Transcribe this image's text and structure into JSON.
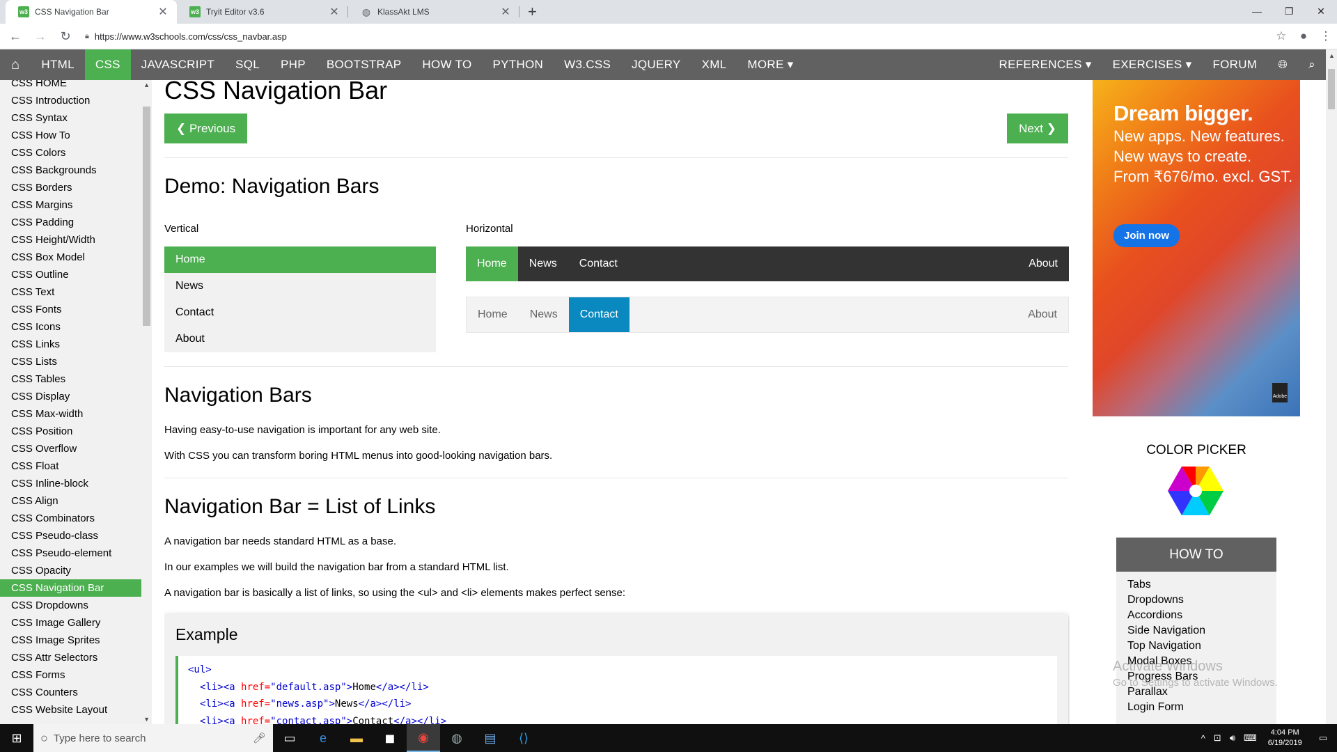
{
  "browser": {
    "tabs": [
      {
        "title": "CSS Navigation Bar",
        "active": true,
        "favicon": "w3schools-icon"
      },
      {
        "title": "Tryit Editor v3.6",
        "active": false,
        "favicon": "w3schools-icon"
      },
      {
        "title": "KlassAkt LMS",
        "active": false,
        "favicon": "globe-icon"
      }
    ],
    "url": "https://www.w3schools.com/css/css_navbar.asp"
  },
  "topnav": {
    "items": [
      "HTML",
      "CSS",
      "JAVASCRIPT",
      "SQL",
      "PHP",
      "BOOTSTRAP",
      "HOW TO",
      "PYTHON",
      "W3.CSS",
      "JQUERY",
      "XML",
      "MORE ▾"
    ],
    "active": "CSS",
    "right_items": [
      "REFERENCES ▾",
      "EXERCISES ▾",
      "FORUM"
    ]
  },
  "sidebar": {
    "links": [
      "CSS HOME",
      "CSS Introduction",
      "CSS Syntax",
      "CSS How To",
      "CSS Colors",
      "CSS Backgrounds",
      "CSS Borders",
      "CSS Margins",
      "CSS Padding",
      "CSS Height/Width",
      "CSS Box Model",
      "CSS Outline",
      "CSS Text",
      "CSS Fonts",
      "CSS Icons",
      "CSS Links",
      "CSS Lists",
      "CSS Tables",
      "CSS Display",
      "CSS Max-width",
      "CSS Position",
      "CSS Overflow",
      "CSS Float",
      "CSS Inline-block",
      "CSS Align",
      "CSS Combinators",
      "CSS Pseudo-class",
      "CSS Pseudo-element",
      "CSS Opacity",
      "CSS Navigation Bar",
      "CSS Dropdowns",
      "CSS Image Gallery",
      "CSS Image Sprites",
      "CSS Attr Selectors",
      "CSS Forms",
      "CSS Counters",
      "CSS Website Layout"
    ],
    "active": "CSS Navigation Bar"
  },
  "main": {
    "title": "CSS Navigation Bar",
    "prev_label": "❮ Previous",
    "next_label": "Next ❯",
    "demo_heading": "Demo: Navigation Bars",
    "vertical_label": "Vertical",
    "horizontal_label": "Horizontal",
    "vertical_items": [
      "Home",
      "News",
      "Contact",
      "About"
    ],
    "horizontal1": {
      "left": [
        "Home",
        "News",
        "Contact"
      ],
      "right": "About",
      "active": "Home"
    },
    "horizontal2": {
      "left": [
        "Home",
        "News",
        "Contact"
      ],
      "right": "About",
      "active": "Contact"
    },
    "navbars_heading": "Navigation Bars",
    "navbars_p1": "Having easy-to-use navigation is important for any web site.",
    "navbars_p2": "With CSS you can transform boring HTML menus into good-looking navigation bars.",
    "list_heading": "Navigation Bar = List of Links",
    "list_p1": "A navigation bar needs standard HTML as a base.",
    "list_p2": "In our examples we will build the navigation bar from a standard HTML list.",
    "list_p3": "A navigation bar is basically a list of links, so using the <ul> and <li> elements makes perfect sense:",
    "example_title": "Example",
    "code": {
      "l1": "<ul>",
      "l2": [
        {
          "c": "t",
          "s": "<li><a "
        },
        {
          "c": "a",
          "s": "href="
        },
        {
          "c": "v",
          "s": "\"default.asp\""
        },
        {
          "c": "t",
          "s": ">"
        },
        {
          "c": "tx",
          "s": "Home"
        },
        {
          "c": "t",
          "s": "</a></li>"
        }
      ],
      "l3": [
        {
          "c": "t",
          "s": "<li><a "
        },
        {
          "c": "a",
          "s": "href="
        },
        {
          "c": "v",
          "s": "\"news.asp\""
        },
        {
          "c": "t",
          "s": ">"
        },
        {
          "c": "tx",
          "s": "News"
        },
        {
          "c": "t",
          "s": "</a></li>"
        }
      ],
      "l4": [
        {
          "c": "t",
          "s": "<li><a "
        },
        {
          "c": "a",
          "s": "href="
        },
        {
          "c": "v",
          "s": "\"contact.asp\""
        },
        {
          "c": "t",
          "s": ">"
        },
        {
          "c": "tx",
          "s": "Contact"
        },
        {
          "c": "t",
          "s": "</a></li>"
        }
      ]
    }
  },
  "ad": {
    "headline": "Dream bigger.",
    "lines": [
      "New apps. New features.",
      "New ways to create.",
      "From ₹676/mo. excl. GST."
    ],
    "cta": "Join now",
    "brand": "Adobe"
  },
  "right": {
    "color_picker_title": "COLOR PICKER",
    "howto_title": "HOW TO",
    "howto_items": [
      "Tabs",
      "Dropdowns",
      "Accordions",
      "Side Navigation",
      "Top Navigation",
      "Modal Boxes",
      "Progress Bars",
      "Parallax",
      "Login Form"
    ],
    "watermark1": "Activate Windows",
    "watermark2": "Go to Settings to activate Windows."
  },
  "taskbar": {
    "search_placeholder": "Type here to search",
    "time": "4:04 PM",
    "date": "6/19/2019"
  },
  "colors": {
    "w3green": "#4caf50",
    "navgray": "#616161",
    "contactblue": "#0a89c1"
  }
}
